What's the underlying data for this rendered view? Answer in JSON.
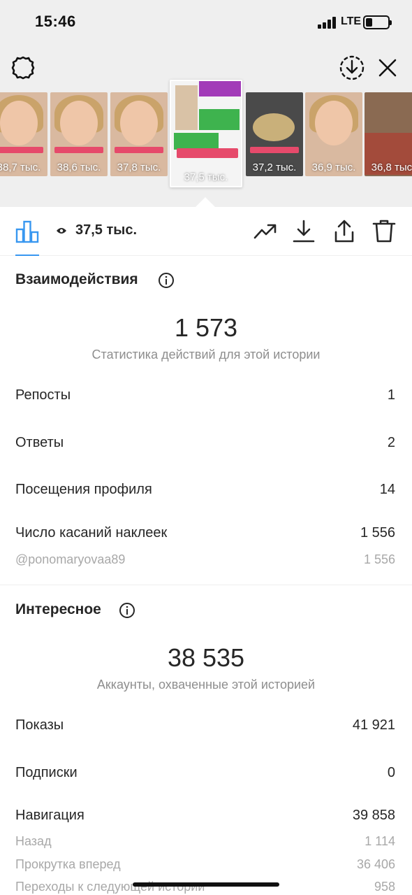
{
  "status_bar": {
    "time": "15:46",
    "network": "LTE",
    "battery_level": 0.3,
    "signal_bars": 4
  },
  "top_toolbar": {
    "settings_icon": "gear-icon",
    "save_icon": "download-circle-icon",
    "close_icon": "close-icon"
  },
  "stories": [
    {
      "views": "38,7 тыс."
    },
    {
      "views": "38,6 тыс."
    },
    {
      "views": "37,8 тыс."
    },
    {
      "views": "37,5 тыс.",
      "selected": true,
      "mention": "@ponomaryovaa89"
    },
    {
      "views": "37,2 тыс."
    },
    {
      "views": "36,9 тыс."
    },
    {
      "views": "36,8 тыс."
    }
  ],
  "action_bar": {
    "insights_icon": "bar-chart-icon",
    "views_icon": "eye-icon",
    "views": "37,5 тыс.",
    "promote_icon": "trend-up-icon",
    "download_icon": "download-icon",
    "share_icon": "share-icon",
    "delete_icon": "trash-icon"
  },
  "interactions": {
    "title": "Взаимодействия",
    "total": "1 573",
    "subtitle": "Статистика действий для этой истории",
    "rows": [
      {
        "label": "Репосты",
        "value": "1"
      },
      {
        "label": "Ответы",
        "value": "2"
      },
      {
        "label": "Посещения профиля",
        "value": "14"
      },
      {
        "label": "Число касаний наклеек",
        "value": "1 556"
      }
    ],
    "sticker": {
      "label": "@ponomaryovaa89",
      "value": "1 556"
    }
  },
  "discovery": {
    "title": "Интересное",
    "total": "38 535",
    "subtitle": "Аккаунты, охваченные этой историей",
    "rows": [
      {
        "label": "Показы",
        "value": "41 921"
      },
      {
        "label": "Подписки",
        "value": "0"
      },
      {
        "label": "Навигация",
        "value": "39 858"
      }
    ],
    "navigation": [
      {
        "label": "Назад",
        "value": "1 114"
      },
      {
        "label": "Прокрутка вперед",
        "value": "36 406"
      },
      {
        "label": "Переходы к следующей истории",
        "value": "958"
      }
    ]
  },
  "colors": {
    "accent": "#3897f0",
    "text": "#262626",
    "secondary": "#8e8e8e",
    "background_top": "#efefef"
  }
}
